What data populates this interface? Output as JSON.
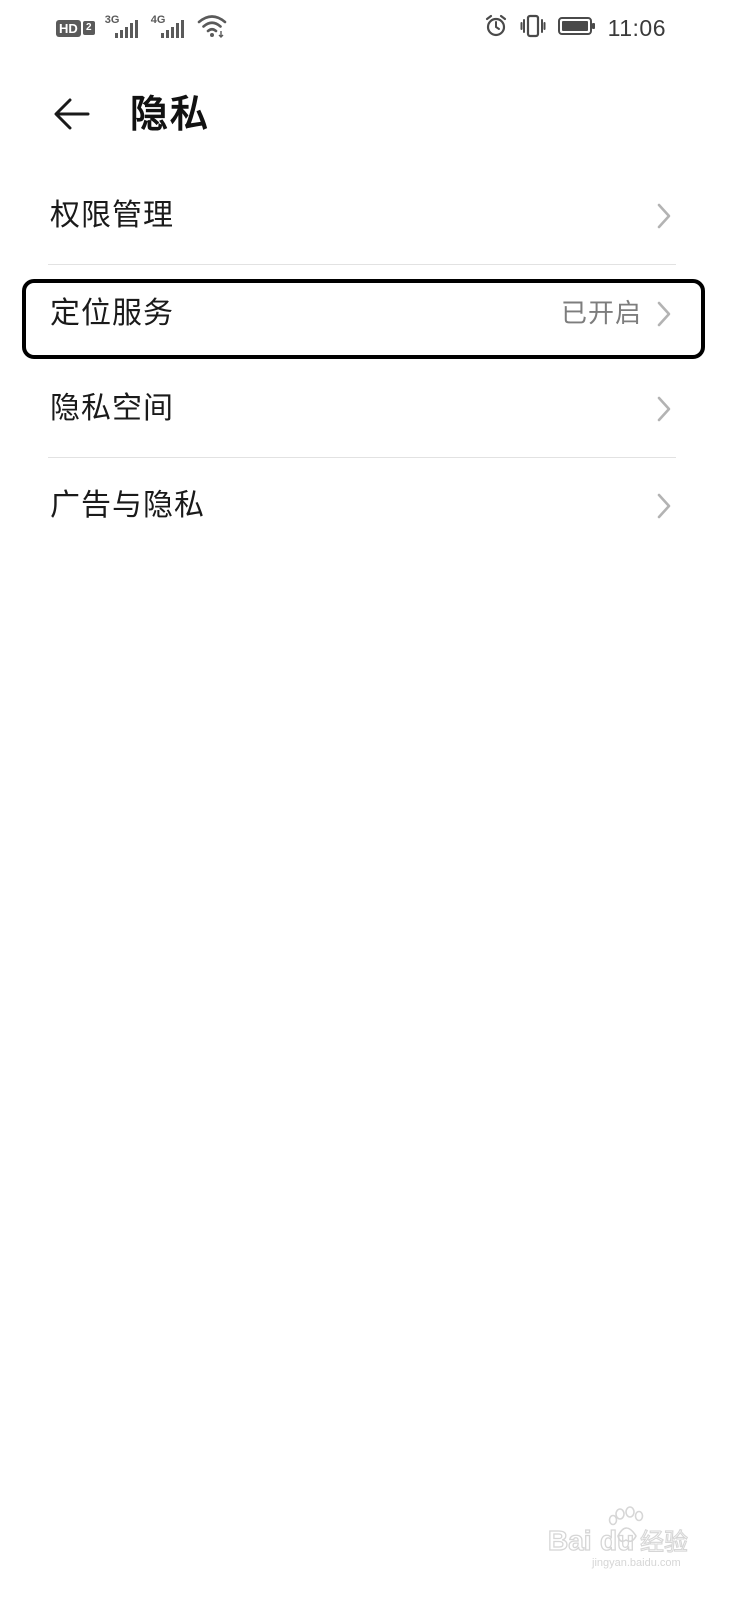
{
  "status_bar": {
    "hd_label": "HD",
    "hd_sub": "2",
    "sim1_net": "3G",
    "sim2_net": "4G",
    "time": "11:06",
    "icons": [
      "hd-call-icon",
      "signal-3g-icon",
      "signal-4g-icon",
      "wifi-icon",
      "alarm-icon",
      "vibrate-icon",
      "battery-icon"
    ]
  },
  "header": {
    "back_icon": "arrow-left-icon",
    "title": "隐私"
  },
  "menu": {
    "items": [
      {
        "label": "权限管理",
        "value": ""
      },
      {
        "label": "定位服务",
        "value": "已开启"
      },
      {
        "label": "隐私空间",
        "value": ""
      },
      {
        "label": "广告与隐私",
        "value": ""
      }
    ],
    "chevron_icon": "chevron-right-icon"
  },
  "watermark": {
    "logo": "baidu-paw-logo",
    "text": "Baidu经验",
    "url": "jingyan.baidu.com"
  },
  "colors": {
    "background": "#ffffff",
    "text_primary": "#1a1a1a",
    "text_secondary": "#7d7d7d",
    "divider": "#e2e2e2",
    "chevron": "#b3b3b3",
    "highlight_border": "#000000"
  }
}
